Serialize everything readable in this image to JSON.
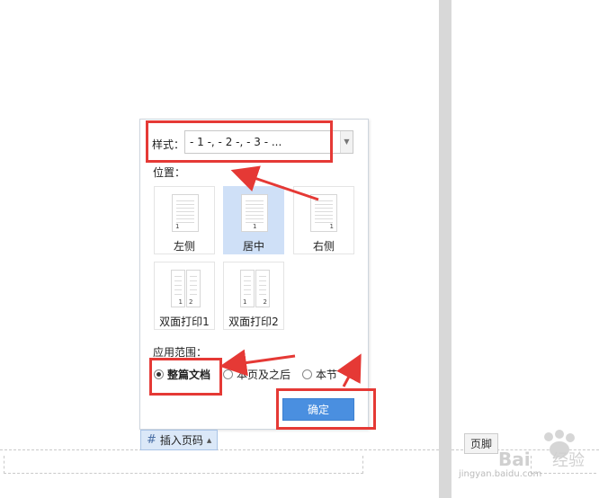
{
  "dialog": {
    "style_label": "样式：",
    "style_value": "- 1 -, - 2 -, - 3 - ...",
    "position_label": "位置：",
    "positions": [
      {
        "label": "左侧",
        "num": "1"
      },
      {
        "label": "居中",
        "num": "1"
      },
      {
        "label": "右侧",
        "num": "1"
      },
      {
        "label": "双面打印1",
        "num1": "1",
        "num2": "2"
      },
      {
        "label": "双面打印2",
        "num1": "1",
        "num2": "2"
      }
    ],
    "selected_position": "居中",
    "scope_label": "应用范围：",
    "scope_options": [
      "整篇文档",
      "本页及之后",
      "本节"
    ],
    "scope_selected": "整篇文档",
    "ok_label": "确定"
  },
  "insert_button": {
    "label": "插入页码",
    "icon": "hash-icon"
  },
  "footer_tag": "页脚",
  "watermark": {
    "text": "jingyan.baidu.com"
  },
  "colors": {
    "highlight": "#e53935",
    "selected_bg": "#cfe0f7",
    "ok_button": "#4a8fe0",
    "gutter": "#d8d8d8"
  }
}
